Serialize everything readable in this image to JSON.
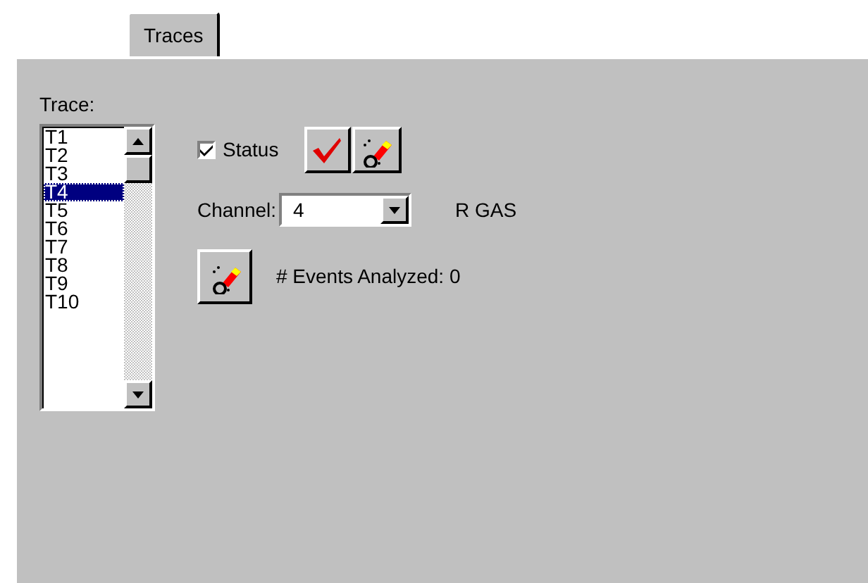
{
  "tabs": [
    {
      "label": "Traces",
      "selected": true
    }
  ],
  "trace_list": {
    "label": "Trace:",
    "items": [
      {
        "label": "T1",
        "selected": false
      },
      {
        "label": "T2",
        "selected": false
      },
      {
        "label": "T3",
        "selected": false
      },
      {
        "label": "T4",
        "selected": true
      },
      {
        "label": "T5",
        "selected": false
      },
      {
        "label": "T6",
        "selected": false
      },
      {
        "label": "T7",
        "selected": false
      },
      {
        "label": "T8",
        "selected": false
      },
      {
        "label": "T9",
        "selected": false
      },
      {
        "label": "T10",
        "selected": false
      }
    ]
  },
  "status": {
    "label": "Status",
    "checked": true
  },
  "channel": {
    "label": "Channel:",
    "value": "4",
    "name": "R GAS"
  },
  "events": {
    "label": "# Events Analyzed:",
    "value": "0"
  }
}
